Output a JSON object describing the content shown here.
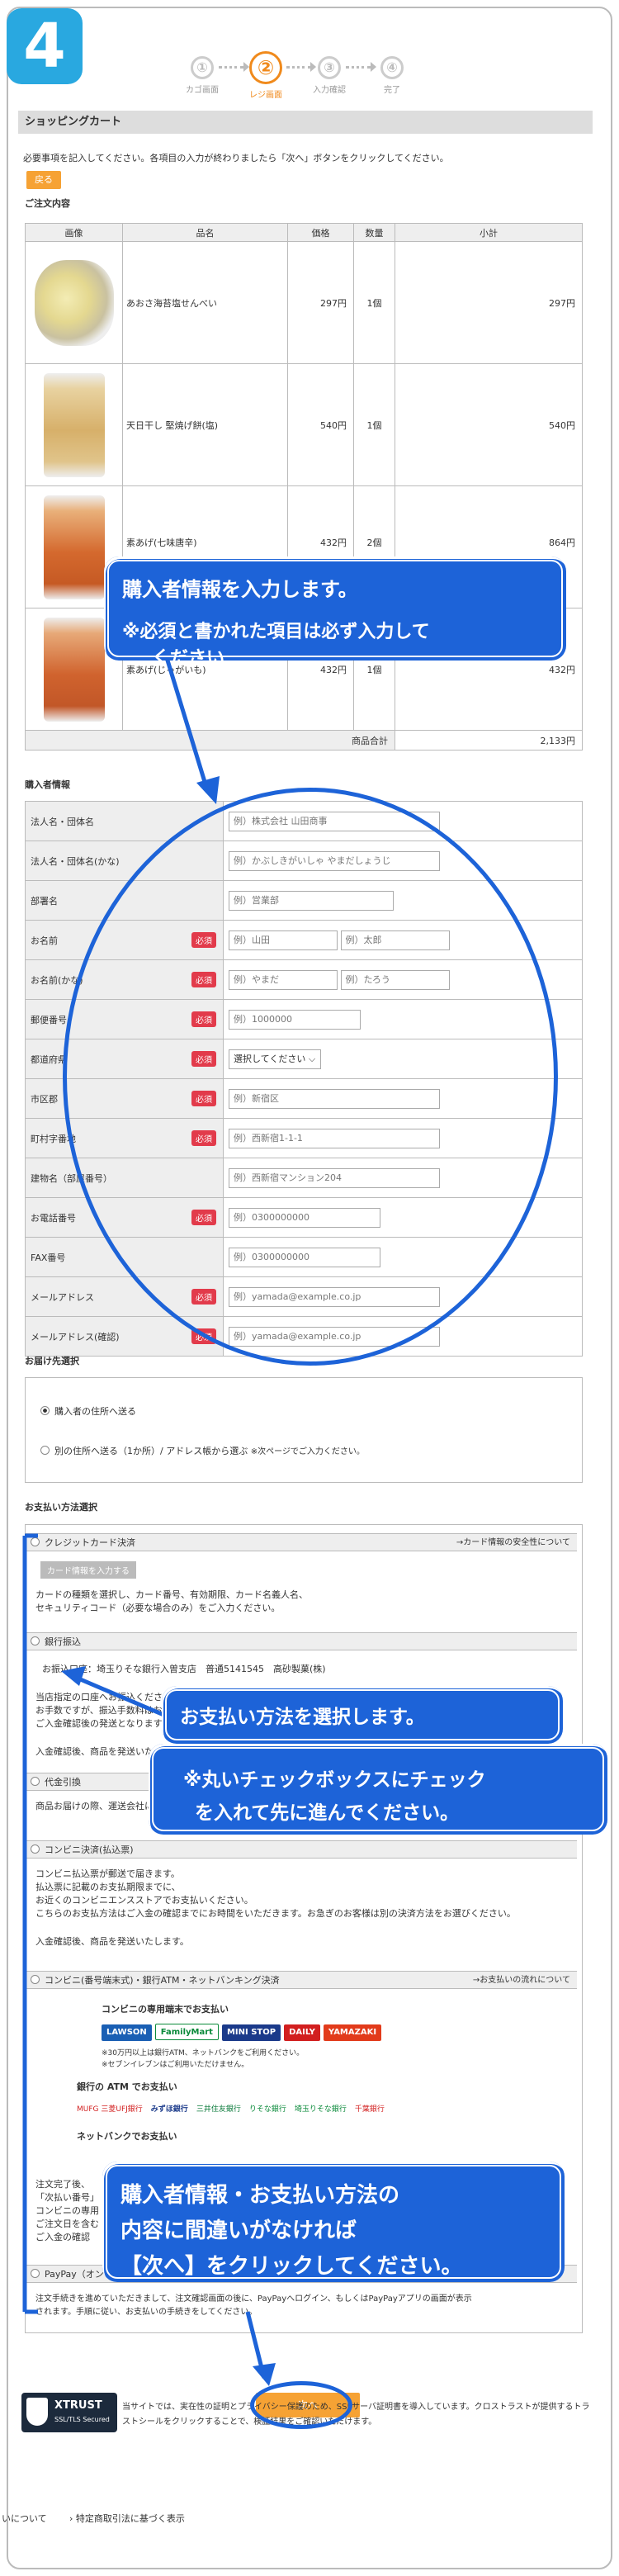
{
  "step_badge": "4",
  "steps": [
    {
      "num": "①",
      "label": "カゴ画面"
    },
    {
      "num": "②",
      "label": "レジ画面"
    },
    {
      "num": "③",
      "label": "入力確認"
    },
    {
      "num": "④",
      "label": "完了"
    }
  ],
  "cart_title": "ショッピングカート",
  "instruction": "必要事項を記入してください。各項目の入力が終わりましたら「次へ」ボタンをクリックしてください。",
  "back_label": "戻る",
  "order_heading": "ご注文内容",
  "order_headers": [
    "画像",
    "品名",
    "価格",
    "数量",
    "小計"
  ],
  "order_rows": [
    {
      "name": "あおさ海苔塩せんべい",
      "price": "297円",
      "qty": "1個",
      "subtotal": "297円"
    },
    {
      "name": "天日干し 堅焼げ餅(塩)",
      "price": "540円",
      "qty": "1個",
      "subtotal": "540円"
    },
    {
      "name": "素あげ(七味唐辛)",
      "price": "432円",
      "qty": "2個",
      "subtotal": "864円"
    },
    {
      "name": "素あげ(じゃがいも)",
      "price": "432円",
      "qty": "1個",
      "subtotal": "432円"
    }
  ],
  "total_label": "商品合計",
  "total_value": "2,133円",
  "buyer_heading": "購入者情報",
  "required": "必須",
  "form": {
    "company": {
      "label": "法人名・団体名",
      "ph": "例）株式会社 山田商事"
    },
    "company_kana": {
      "label": "法人名・団体名(かな)",
      "ph": "例）かぶしきがいしゃ やまだしょうじ"
    },
    "dept": {
      "label": "部署名",
      "ph": "例）営業部"
    },
    "name": {
      "label": "お名前",
      "ph1": "例）山田",
      "ph2": "例）太郎"
    },
    "name_kana": {
      "label": "お名前(かな)",
      "ph1": "例）やまだ",
      "ph2": "例）たろう"
    },
    "zip": {
      "label": "郵便番号",
      "ph": "例）1000000"
    },
    "pref": {
      "label": "都道府県",
      "value": "選択してください"
    },
    "city": {
      "label": "市区郡",
      "ph": "例）新宿区"
    },
    "town": {
      "label": "町村字番地",
      "ph": "例）西新宿1-1-1"
    },
    "building": {
      "label": "建物名（部屋番号）",
      "ph": "例）西新宿マンション204"
    },
    "tel": {
      "label": "お電話番号",
      "ph": "例）0300000000"
    },
    "fax": {
      "label": "FAX番号",
      "ph": "例）0300000000"
    },
    "mail": {
      "label": "メールアドレス",
      "ph": "例）yamada@example.co.jp"
    },
    "mail2": {
      "label": "メールアドレス(確認)",
      "ph": "例）yamada@example.co.jp"
    }
  },
  "ship_heading": "お届け先選択",
  "ship_opt1": "購入者の住所へ送る",
  "ship_opt2": "別の住所へ送る（1か所）/ アドレス帳から選ぶ",
  "ship_opt2_note": "※次ページでご入力ください。",
  "pay_heading": "お支払い方法選択",
  "pay": {
    "card": {
      "label": "クレジットカード決済",
      "link": "→カード情報の安全性について",
      "button": "カード情報を入力する",
      "desc1": "カードの種類を選択し、カード番号、有効期限、カード名義人名、",
      "desc2": "セキュリティコード（必要な場合のみ）をご入力ください。"
    },
    "bank": {
      "label": "銀行振込",
      "account": "お振込口座：埼玉りそな銀行入曽支店　普通5141545　高砂製菓(株)",
      "d1": "当店指定の口座へお振込ください。",
      "d2": "お手数ですが、振込手数料はお客様ご負担でお願いいたします。",
      "d3": "ご入金確認後の発送となります。",
      "d4": "入金確認後、商品を発送いたします。"
    },
    "cod": {
      "label": "代金引換",
      "desc": "商品お届けの際、運送会社にお支払いください。"
    },
    "conv": {
      "label": "コンビニ決済(払込票)",
      "d1": "コンビニ払込票が郵送で届きます。",
      "d2": "払込票に記載のお支払期限までに、",
      "d3": "お近くのコンビニエンスストアでお支払いください。",
      "d4": "こちらのお支払方法はご入金の確認までにお時間をいただきます。お急ぎのお客様は別の決済方法をお選びください。",
      "d5": "入金確認後、商品を発送いたします。"
    },
    "multi": {
      "label": "コンビニ(番号端末式)・銀行ATM・ネットバンキング決済",
      "link": "→お支払いの流れについて",
      "t1": "コンビニの専用端末でお支払い",
      "note1": "※30万円以上は銀行ATM、ネットバンクをご利用ください。",
      "note2": "※セブンイレブンはご利用いただけません。",
      "t2": "銀行の ATM でお支払い",
      "t3": "ネットバンクでお支払い",
      "d1": "注文完了後、",
      "d2": "「次払い番号」",
      "d3": "コンビニの専用",
      "d4": "ご注文日を含む",
      "d5": "ご入金の確認"
    },
    "paypay": {
      "label": "PayPay（オンライン決済）",
      "d1": "注文手続きを進めていただきまして、注文確認画面の後に、PayPayへログイン、もしくはPayPayアプリの画面が表示",
      "d2": "されます。手順に従い、お支払いの手続きをしてください。"
    }
  },
  "stores": [
    "LAWSON",
    "FamilyMart",
    "MINI STOP",
    "DAILY",
    "YAMAZAKI"
  ],
  "banks": [
    "MUFG 三菱UFJ銀行",
    "みずほ銀行",
    "三井住友銀行",
    "りそな銀行",
    "埼玉りそな銀行",
    "千葉銀行"
  ],
  "next_label": "次へ",
  "ssl_badge": "XTRUST",
  "ssl_sub": "SSL/TLS Secured",
  "ssl_text1": "当サイトでは、実在性の証明とプライバシー保護のため、SSLサーバ証明書を導入しています。クロストラストが提供するトラ",
  "ssl_text2": "ストシールをクリックすることで、検証結果をご確認いただけます。",
  "footer_left": "いについて",
  "footer_right": "特定商取引法に基づく表示",
  "callouts": {
    "c1a": "購入者情報を入力します。",
    "c1b": "※必須と書かれた項目は必ず入力して",
    "c1c": "ください",
    "c2a": "お支払い方法を選択します。",
    "c3a": "※丸いチェックボックスにチェック",
    "c3b": "を入れて先に進んでください。",
    "c4a": "購入者情報・お支払い方法の",
    "c4b": "内容に間違いがなければ",
    "c4c": "【次へ】をクリックしてください。"
  },
  "colors": {
    "accent": "#f08a1c",
    "callout": "#1d63d8",
    "badge": "#29a8e0",
    "required": "#e23b4b"
  }
}
